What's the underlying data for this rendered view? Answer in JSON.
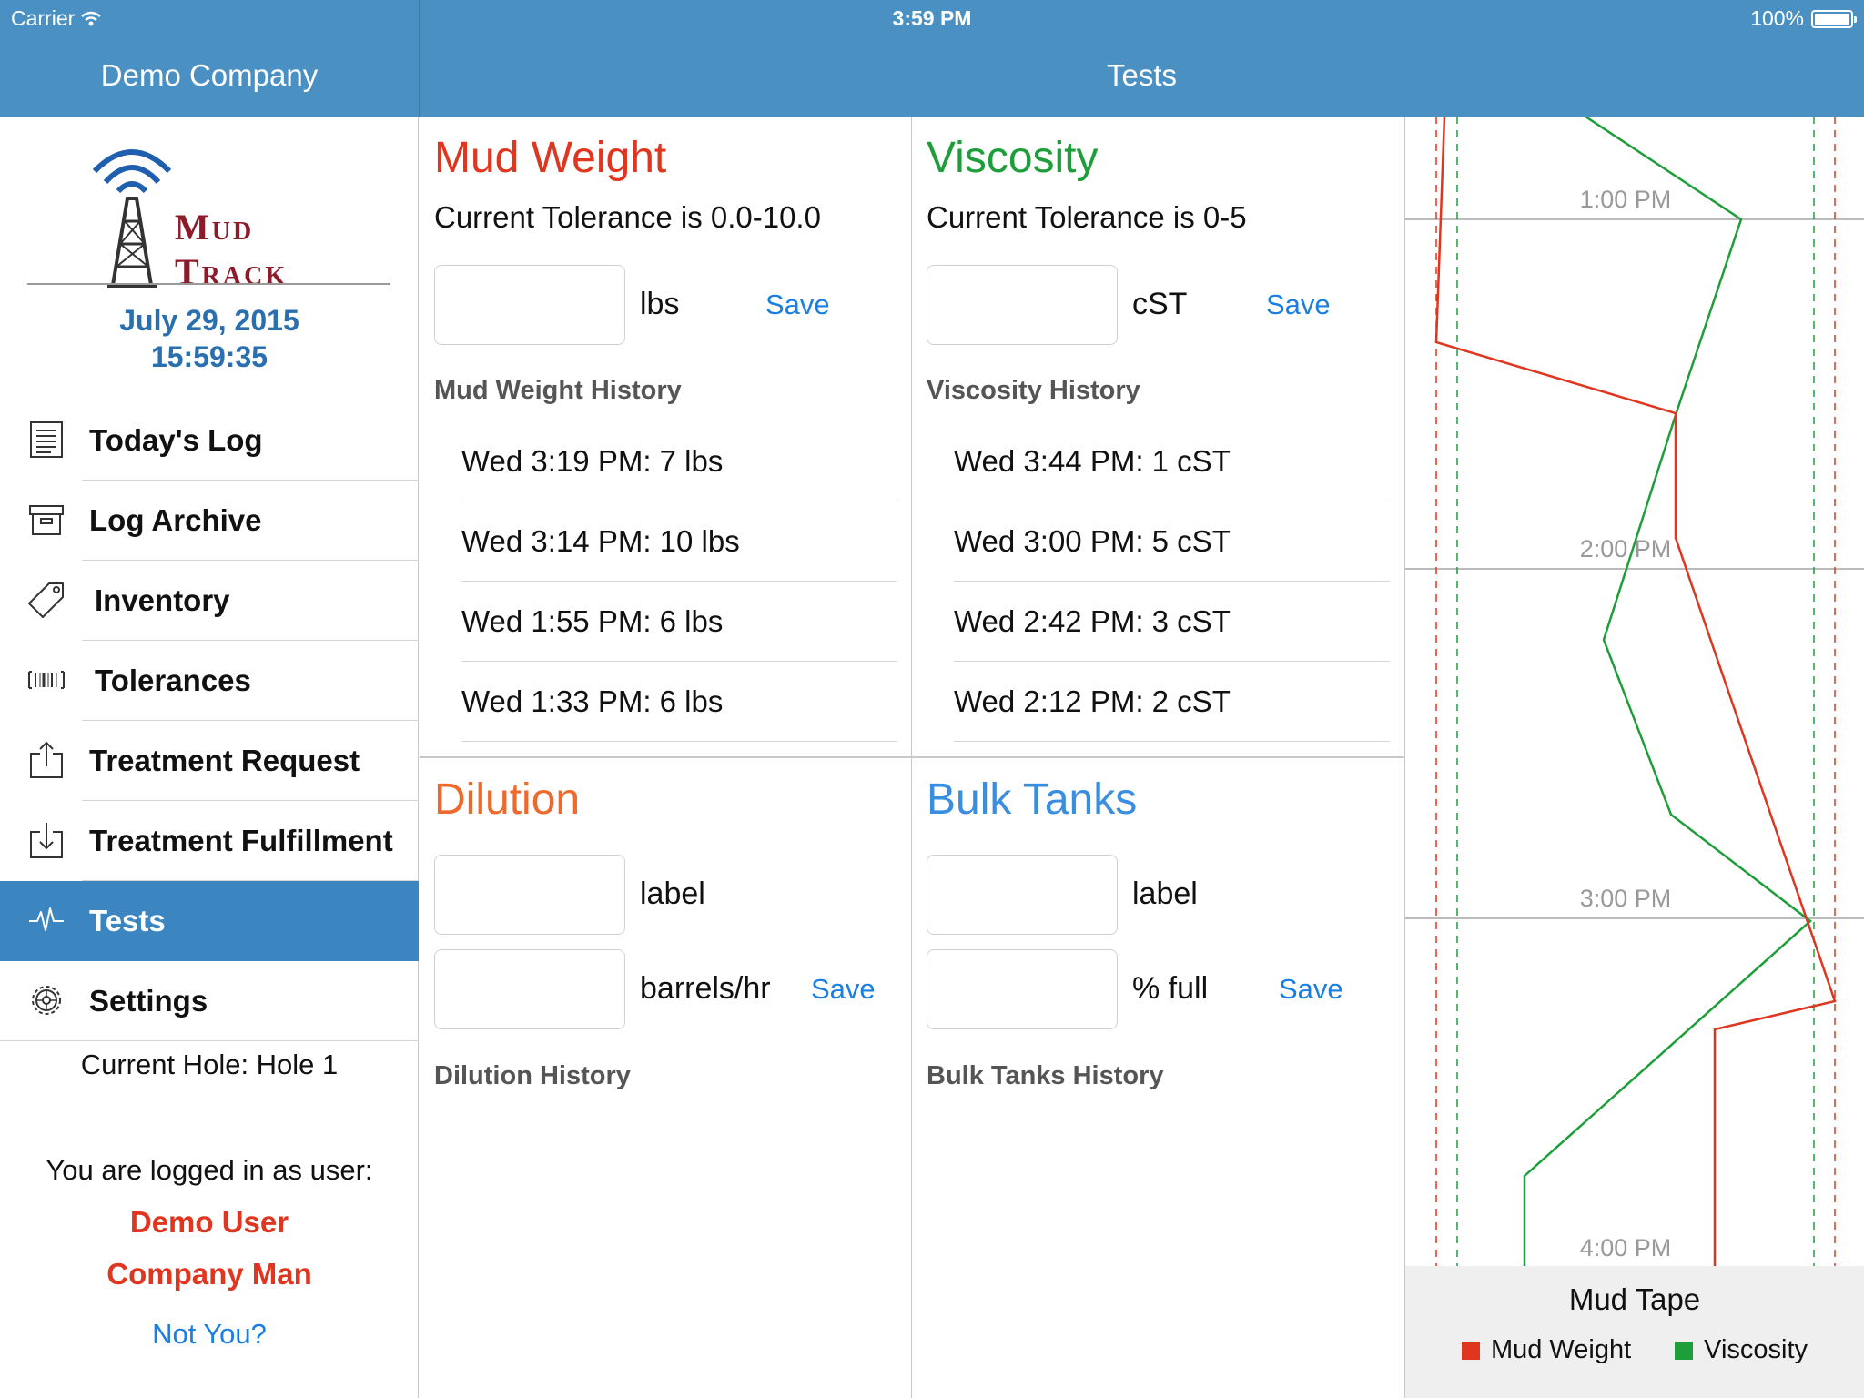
{
  "status": {
    "carrier": "Carrier",
    "time": "3:59 PM",
    "battery": "100%"
  },
  "nav": {
    "left_title": "Demo Company",
    "right_title": "Tests"
  },
  "sidebar": {
    "logo_line1": "Mud",
    "logo_line2": "Track",
    "date": "July 29, 2015",
    "clock": "15:59:35",
    "items": [
      {
        "label": "Today's Log",
        "icon": "document-icon"
      },
      {
        "label": "Log Archive",
        "icon": "archive-box-icon"
      },
      {
        "label": "Inventory",
        "icon": "tag-icon"
      },
      {
        "label": "Tolerances",
        "icon": "barcode-icon"
      },
      {
        "label": "Treatment Request",
        "icon": "upload-icon"
      },
      {
        "label": "Treatment Fulfillment",
        "icon": "download-icon"
      },
      {
        "label": "Tests",
        "icon": "pulse-icon",
        "active": true
      },
      {
        "label": "Settings",
        "icon": "gear-icon"
      }
    ],
    "current_hole": "Current Hole: Hole 1",
    "logged_in_text": "You are logged in as user:",
    "user_name": "Demo User",
    "user_role": "Company Man",
    "not_you": "Not You?"
  },
  "panels": {
    "mud_weight": {
      "title": "Mud Weight",
      "tolerance": "Current Tolerance is 0.0-10.0",
      "unit": "lbs",
      "save": "Save",
      "history_title": "Mud Weight History",
      "history": [
        "Wed 3:19 PM: 7 lbs",
        "Wed 3:14 PM: 10 lbs",
        "Wed 1:55 PM: 6 lbs",
        "Wed 1:33 PM: 6 lbs"
      ],
      "color": "#e0351e"
    },
    "viscosity": {
      "title": "Viscosity",
      "tolerance": "Current Tolerance is 0-5",
      "unit": "cST",
      "save": "Save",
      "history_title": "Viscosity History",
      "history": [
        "Wed 3:44 PM: 1 cST",
        "Wed 3:00 PM: 5 cST",
        "Wed 2:42 PM: 3 cST",
        "Wed 2:12 PM: 2 cST"
      ],
      "color": "#1e9e3a"
    },
    "dilution": {
      "title": "Dilution",
      "unit1": "label",
      "unit2": "barrels/hr",
      "save": "Save",
      "history_title": "Dilution History",
      "color": "#ee6a2c"
    },
    "bulk_tanks": {
      "title": "Bulk Tanks",
      "unit1": "label",
      "unit2": "% full",
      "save": "Save",
      "history_title": "Bulk Tanks History",
      "color": "#3a8ee0"
    }
  },
  "mud_tape": {
    "title": "Mud Tape",
    "legend": [
      {
        "name": "Mud Weight",
        "color": "#e0351e"
      },
      {
        "name": "Viscosity",
        "color": "#1e9e3a"
      }
    ],
    "time_labels": [
      "1:00 PM",
      "2:00 PM",
      "3:00 PM",
      "4:00 PM"
    ]
  }
}
